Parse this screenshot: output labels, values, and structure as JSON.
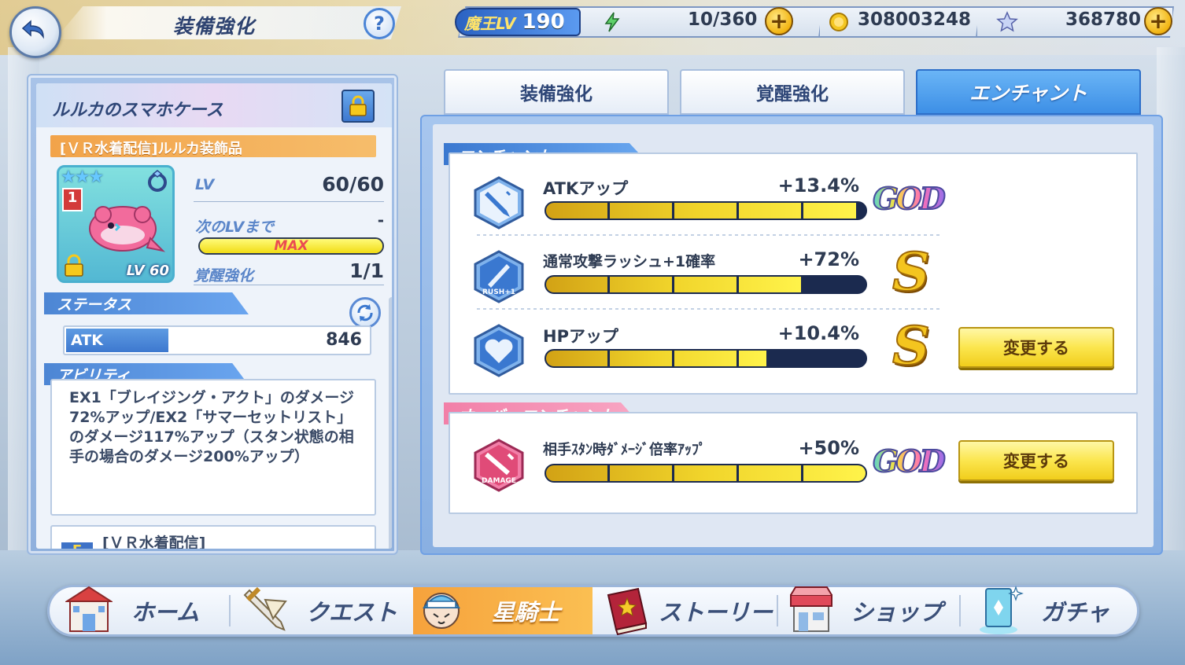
{
  "header": {
    "title": "装備強化",
    "help_label": "?",
    "demon_lv_label": "魔王LV",
    "demon_lv_value": "190",
    "stamina": "10/360",
    "coins": "308003248",
    "stars": "368780"
  },
  "item": {
    "name": "ルルカのスマホケース",
    "subtitle": "[ＶＲ水着配信]ルルカ装飾品",
    "rank": "1",
    "card_lv": "LV 60",
    "lv_label": "LV",
    "lv_value": "60/60",
    "next_lv_label": "次のLVまで",
    "next_lv_value": "-",
    "next_lv_bar": "MAX",
    "awaken_label": "覚醒強化",
    "awaken_value": "1/1"
  },
  "status": {
    "section_label": "ステータス",
    "atk_label": "ATK",
    "atk_value": "846"
  },
  "ability": {
    "section_label": "アビリティ",
    "text": "EX1「ブレイジング・アクト」のダメージ72%アップ/EX2「サマーセットリスト」のダメージ117%アップ（スタン状態の相手の場合のダメージ200%アップ）",
    "second_label": "[ＶＲ水着配信]",
    "second_badge": "E"
  },
  "tabs": [
    {
      "label": "装備強化",
      "active": false
    },
    {
      "label": "覚醒強化",
      "active": false
    },
    {
      "label": "エンチャント",
      "active": true
    }
  ],
  "enchant": {
    "section_label": "エンチャント",
    "rows": [
      {
        "name": "ATKアップ",
        "pct": "+13.4%",
        "fill": 0.97,
        "grade": "GOD",
        "icon": "sword-icon"
      },
      {
        "name": "通常攻撃ラッシュ+1確率",
        "pct": "+72%",
        "fill": 0.8,
        "grade": "S",
        "icon": "rush-icon"
      },
      {
        "name": "HPアップ",
        "pct": "+10.4%",
        "fill": 0.69,
        "grade": "S",
        "icon": "heart-icon"
      }
    ],
    "change_label": "変更する"
  },
  "over_enchant": {
    "section_label": "オーバーエンチャント",
    "name": "相手ｽﾀﾝ時ﾀﾞﾒｰｼﾞ倍率ｱｯﾌﾟ",
    "pct": "+50%",
    "fill": 1.0,
    "grade": "GOD",
    "change_label": "変更する"
  },
  "nav": [
    {
      "label": "ホーム",
      "icon": "home-icon",
      "active": false
    },
    {
      "label": "クエスト",
      "icon": "quest-sword-icon",
      "active": false
    },
    {
      "label": "星騎士",
      "icon": "knight-icon",
      "active": true
    },
    {
      "label": "ストーリー",
      "icon": "book-icon",
      "active": false
    },
    {
      "label": "ショップ",
      "icon": "shop-icon",
      "active": false
    },
    {
      "label": "ガチャ",
      "icon": "gacha-card-icon",
      "active": false
    }
  ],
  "colors": {
    "accent_blue": "#3d8fe6",
    "gold": "#f1d52b",
    "orange": "#f6a23c"
  }
}
